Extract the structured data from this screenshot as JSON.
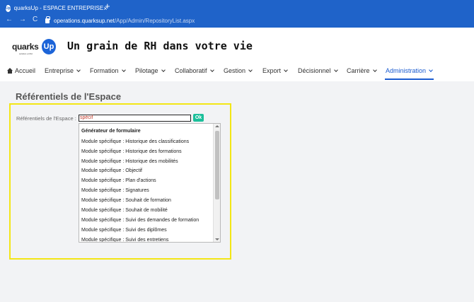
{
  "browser": {
    "tab_icon": "Up",
    "tab_title": "quarksUp - ESPACE ENTREPRISE",
    "close_icon": "×",
    "new_tab_icon": "+",
    "url_host": "operations.quarksup.net",
    "url_path": "/App/Admin/RepositoryList.aspx",
    "back_icon": "←",
    "forward_icon": "→",
    "reload_icon": "C"
  },
  "header": {
    "logo_text": "quarks",
    "logo_badge": "Up",
    "logo_sub": "solution et RH",
    "slogan": "Un grain de RH dans votre vie"
  },
  "menu": {
    "items": [
      {
        "label": "Accueil"
      },
      {
        "label": "Entreprise"
      },
      {
        "label": "Formation"
      },
      {
        "label": "Pilotage"
      },
      {
        "label": "Collaboratif"
      },
      {
        "label": "Gestion"
      },
      {
        "label": "Export"
      },
      {
        "label": "Décisionnel"
      },
      {
        "label": "Carrière"
      },
      {
        "label": "Administration"
      }
    ],
    "active": "Administration"
  },
  "page": {
    "title": "Référentiels de l'Espace",
    "field_label": "Référentiels de l'Espace :",
    "input_value": "spécif",
    "ok_label": "Ok"
  },
  "dropdown": {
    "items": [
      "Générateur de formulaire",
      "Module spécifique : Historique des classifications",
      "Module spécifique : Historique des formations",
      "Module spécifique : Historique des mobilités",
      "Module spécifique : Objectif",
      "Module spécifique : Plan d'actions",
      "Module spécifique : Signatures",
      "Module spécifique : Souhait de formation",
      "Module spécifique : Souhait de mobilité",
      "Module spécifique : Suivi des demandes de formation",
      "Module spécifique : Suivi des diplômes",
      "Module spécifique : Suivi des entretiens"
    ]
  },
  "colors": {
    "browser_blue": "#1f63c9",
    "brand_blue": "#1c64d8",
    "ok_green": "#1bbf9a",
    "highlight_yellow": "#f3e615"
  }
}
